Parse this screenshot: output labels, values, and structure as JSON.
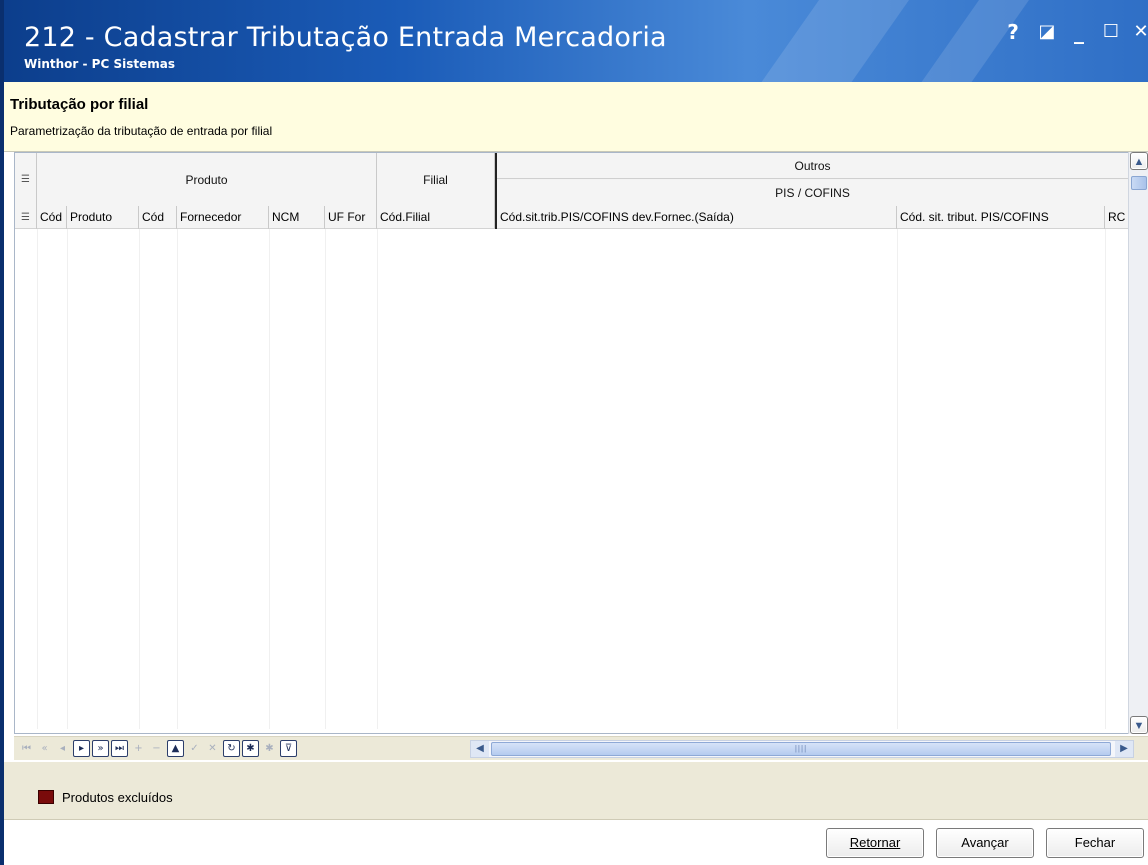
{
  "window": {
    "title": "212 - Cadastrar Tributação Entrada Mercadoria",
    "subtitle": "Winthor - PC Sistemas",
    "controls": {
      "help": "?",
      "restore": "◪",
      "minimize": "_",
      "maximize": "☐",
      "close": "✕"
    }
  },
  "info": {
    "title": "Tributação por filial",
    "description": "Parametrização da tributação de entrada por filial"
  },
  "grid": {
    "bands": {
      "produto": "Produto",
      "filial": "Filial",
      "outros": "Outros",
      "pis_cofins": "PIS / COFINS"
    },
    "columns": [
      "Cód",
      "Produto",
      "Cód",
      "Fornecedor",
      "NCM",
      "UF For",
      "Cód.Filial",
      "Cód.sit.trib.PIS/COFINS dev.Fornec.(Saída)",
      "Cód. sit. tribut. PIS/COFINS",
      "RC"
    ],
    "rows": []
  },
  "navigator": {
    "first": "⏮",
    "prior_page": "«",
    "prior": "◂",
    "next": "▸",
    "next_page": "»",
    "last": "⏭",
    "insert": "+",
    "delete": "−",
    "edit": "▲",
    "post": "✓",
    "cancel": "✕",
    "refresh": "↻",
    "bookmark": "✱",
    "goto_bookmark": "✱",
    "filter": "⊽"
  },
  "legend": {
    "label": "Produtos excluídos",
    "color": "#7a0b0b"
  },
  "buttons": {
    "retornar": "Retornar",
    "avancar": "Avançar",
    "fechar": "Fechar"
  },
  "colors": {
    "titlebar": "#1b5cb8",
    "info_bg": "#fffde0",
    "panel_bg": "#ece9d8"
  }
}
